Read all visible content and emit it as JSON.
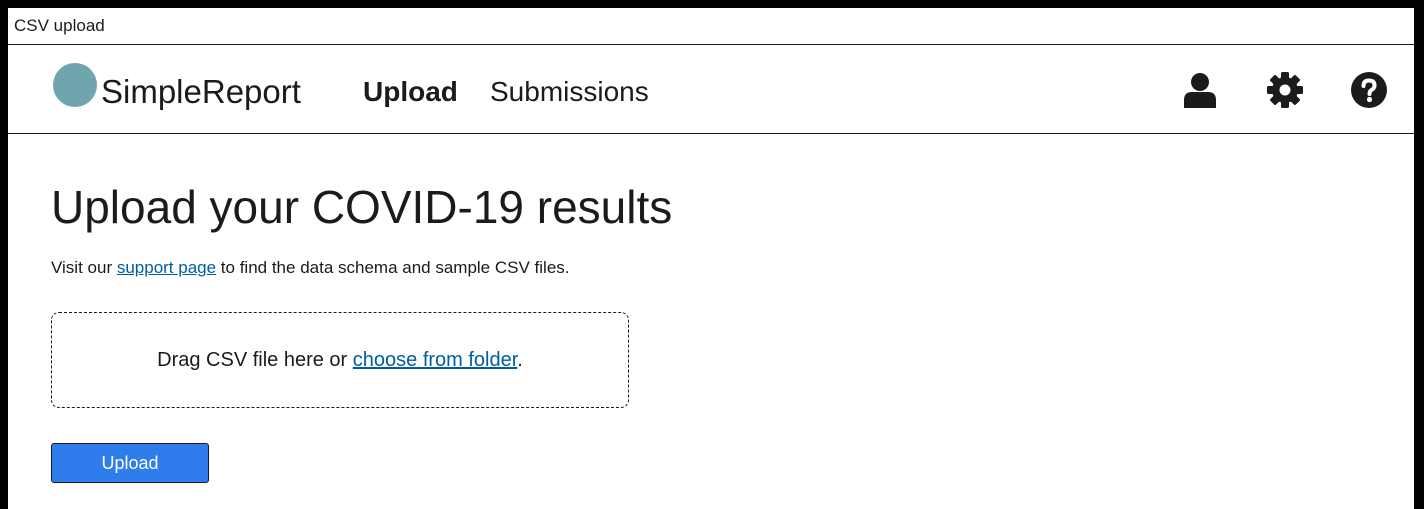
{
  "window": {
    "title": "CSV upload"
  },
  "header": {
    "brand": "SimpleReport",
    "nav": [
      {
        "label": "Upload",
        "active": true
      },
      {
        "label": "Submissions",
        "active": false
      }
    ],
    "icons": [
      "user-icon",
      "gear-icon",
      "help-icon"
    ],
    "logo_color": "#71a5ad"
  },
  "main": {
    "title": "Upload your COVID-19 results",
    "intro": {
      "before": "Visit our ",
      "link": "support page",
      "after": " to find the data schema and sample CSV files."
    },
    "dropzone": {
      "before": "Drag CSV file here or ",
      "link": "choose from folder",
      "after": "."
    },
    "upload_button": "Upload"
  },
  "colors": {
    "link": "#005ea2",
    "button": "#2f7cec",
    "text": "#1b1b1b"
  }
}
